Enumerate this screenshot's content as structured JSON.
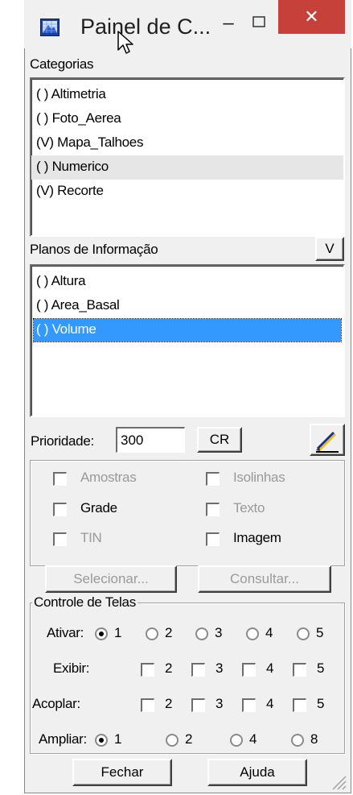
{
  "window": {
    "title": "Painel de C...",
    "min_glyph": "–",
    "close_glyph": "✕",
    "close_color": "#c7413b"
  },
  "categorias": {
    "label": "Categorias",
    "items": [
      {
        "label": "( ) Altimetria"
      },
      {
        "label": "( ) Foto_Aerea"
      },
      {
        "label": "(V) Mapa_Talhoes"
      },
      {
        "label": "( ) Numerico",
        "highlighted": true
      },
      {
        "label": "(V) Recorte"
      }
    ]
  },
  "planos": {
    "label": "Planos de Informação",
    "v_button": "V",
    "items": [
      {
        "label": "( ) Altura"
      },
      {
        "label": "( ) Area_Basal"
      },
      {
        "label": "( ) Volume",
        "selected": true
      }
    ],
    "selection_color": "#3399ff"
  },
  "prioridade": {
    "label": "Prioridade:",
    "value": "300",
    "cr_button": "CR",
    "edit_icon": "pencil-icon"
  },
  "representations": {
    "amostras": {
      "label": "Amostras",
      "enabled": false,
      "checked": false
    },
    "isolinhas": {
      "label": "Isolinhas",
      "enabled": false,
      "checked": false
    },
    "grade": {
      "label": "Grade",
      "enabled": true,
      "checked": false
    },
    "texto": {
      "label": "Texto",
      "enabled": false,
      "checked": false
    },
    "tin": {
      "label": "TIN",
      "enabled": false,
      "checked": false
    },
    "imagem": {
      "label": "Imagem",
      "enabled": true,
      "checked": false
    }
  },
  "actions": {
    "selecionar": "Selecionar...",
    "consultar": "Consultar..."
  },
  "telas": {
    "group_label": "Controle de Telas",
    "ativar": {
      "label": "Ativar:",
      "options": [
        "1",
        "2",
        "3",
        "4",
        "5"
      ],
      "selected": "1"
    },
    "exibir": {
      "label": "Exibir:",
      "options": [
        "2",
        "3",
        "4",
        "5"
      ]
    },
    "acoplar": {
      "label": "Acoplar:",
      "options": [
        "2",
        "3",
        "4",
        "5"
      ]
    },
    "ampliar": {
      "label": "Ampliar:",
      "options": [
        "1",
        "2",
        "4",
        "8"
      ],
      "selected": "1"
    }
  },
  "footer": {
    "fechar": "Fechar",
    "ajuda": "Ajuda"
  }
}
